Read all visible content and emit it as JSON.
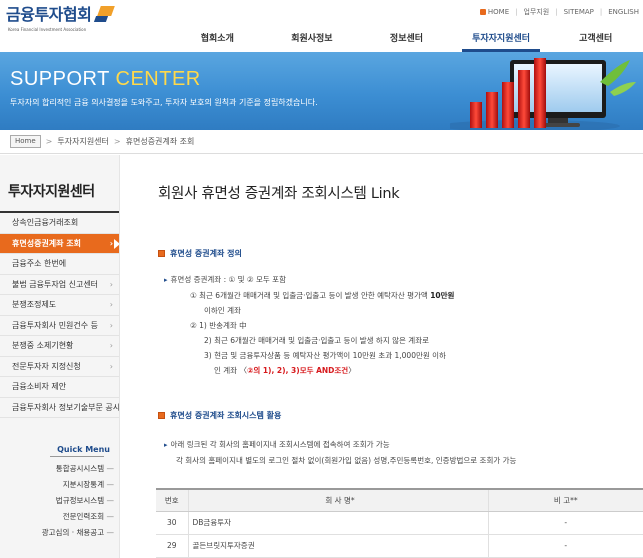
{
  "header": {
    "logo_text": "금융투자협회",
    "logo_sub": "Korea Financial Investment Association",
    "util_links": [
      "HOME",
      "업무지원",
      "SITEMAP",
      "ENGLISH"
    ],
    "nav": [
      "협회소개",
      "회원사정보",
      "정보센터",
      "투자자지원센터",
      "고객센터"
    ],
    "active_nav": "투자자지원센터"
  },
  "banner": {
    "title_a": "SUPPORT ",
    "title_b": "CENTER",
    "subtitle": "투자자의 합리적인 금융 의사결정을 도와주고, 투자자 보호의 원칙과 기준을 정립하겠습니다."
  },
  "breadcrumb": {
    "home": "Home",
    "items": [
      "투자자지원센터",
      "휴면성증권계좌 조회"
    ]
  },
  "sidebar": {
    "title": "투자자지원센터",
    "items": [
      {
        "label": "상속인금융거래조회",
        "active": false
      },
      {
        "label": "휴면성증권계좌 조회",
        "active": true
      },
      {
        "label": "금융주소 한번에",
        "active": false
      },
      {
        "label": "불법 금융투자업 신고센터",
        "active": false
      },
      {
        "label": "분쟁조정제도",
        "active": false
      },
      {
        "label": "금융투자회사 민원건수 등",
        "active": false
      },
      {
        "label": "분쟁중 소제기현황",
        "active": false
      },
      {
        "label": "전문투자자 지정신청",
        "active": false
      },
      {
        "label": "금융소비자 제안",
        "active": false
      },
      {
        "label": "금융투자회사 정보기술부문 공시",
        "active": false
      }
    ],
    "quick_title": "Quick Menu",
    "quick_items": [
      "통합공시시스템",
      "지분시장통계",
      "법규정보시스템",
      "전문인력조회",
      "광고심의 · 채용공고"
    ]
  },
  "content": {
    "page_title": "회원사 휴면성 증권계좌 조회시스템 Link",
    "section1_title": "휴면성 증권계좌 정의",
    "section1": {
      "line1_prefix": "휴면성 증권계좌 : ",
      "line1_rest": "① 및 ② 모두 포함",
      "line2": "① 최근 6개월간 매매거래 및 입출금·입출고 등이 발생 안한 예탁자산 평가액 ",
      "line2_bold": "10만원",
      "line3": "이하인 계좌",
      "line4": "② 1) 반송계좌 中",
      "line5": "2) 최근 6개월간 매매거래 및 입출금·입출고 등이 발생 하지 않은 계좌로",
      "line6": "3) 현금 및 금융투자상품 등 예탁자산 평가액이 10만원 초과 1,000만원 이하",
      "line7_prefix": "인 계좌 〈",
      "line7_red": "②의 1), 2), 3)모두 AND조건",
      "line7_suffix": "〉"
    },
    "section2_title": "휴면성 증권계좌 조회시스템 활용",
    "section2": {
      "line1": "아래 링크된 각 회사의 홈페이지내 조회시스템에 접속하여 조회가 가능",
      "line2": "각 회사의 홈페이지내 별도의 로그인 절차 없이(회원가입 없음) 성명,주민등록번호, 인증방법으로 조회가 가능"
    },
    "table": {
      "headers": [
        "번호",
        "회 사 명*",
        "비 고**"
      ],
      "rows": [
        [
          "30",
          "DB금융투자",
          "-"
        ],
        [
          "29",
          "골든브릿지투자증권",
          "-"
        ]
      ]
    }
  },
  "colors": {
    "accent": "#e86a1d",
    "brand": "#1f4c8c",
    "banner": "#3c8ed3"
  }
}
